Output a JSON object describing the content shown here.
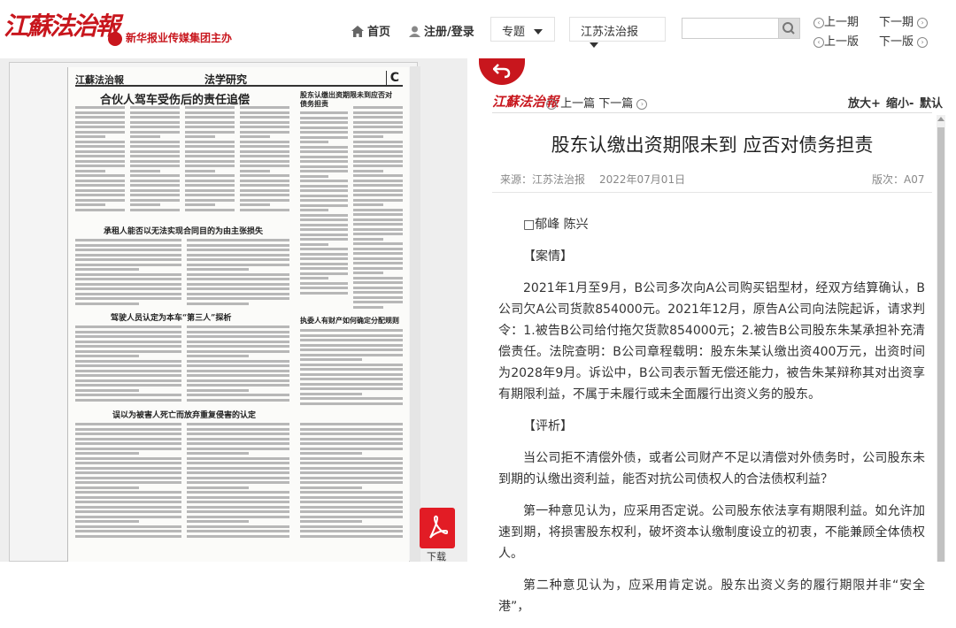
{
  "header": {
    "logo_text": "江蘇法治報",
    "logo_sub": "新华报业传媒集团主办",
    "nav_home": "首页",
    "nav_login": "注册/登录",
    "dropdown_topic": "专题",
    "dropdown_paper": "江苏法治报",
    "prev_issue": "上一期",
    "next_issue": "下一期",
    "prev_page": "上一版",
    "next_page": "下一版"
  },
  "newspaper": {
    "masthead": "江蘇法治報",
    "section": "法学研究",
    "page_letter": "C",
    "headlines": [
      "合伙人驾车受伤后的责任追偿",
      "股东认缴出资期限未到应否对债务担责",
      "承租人能否以无法实现合同目的为由主张损失",
      "驾驶人员认定为本车“第三人”探析",
      "执委人有财产如何确定分配规则",
      "误以为被害人死亡而放弃重复侵害的认定"
    ],
    "download_label": "下载"
  },
  "article": {
    "logo": "江蘇法治報",
    "prev_article": "上一篇",
    "next_article": "下一篇",
    "zoom_in": "放大+",
    "zoom_out": "缩小-",
    "default_size": "默认",
    "title": "股东认缴出资期限未到 应否对债务担责",
    "source": "来源：江苏法治报",
    "date": "2022年07月01日",
    "edition": "版次：A07",
    "author": "□郁峰 陈兴",
    "section_case": "【案情】",
    "para_case": "2021年1月至9月，B公司多次向A公司购买铝型材，经双方结算确认，B公司欠A公司货款854000元。2021年12月，原告A公司向法院起诉，请求判令：1.被告B公司给付拖欠货款854000元；2.被告B公司股东朱某承担补充清偿责任。法院查明：B公司章程载明：股东朱某认缴出资400万元，出资时间为2028年9月。诉讼中，B公司表示暂无偿还能力，被告朱某辩称其对出资享有期限利益，不属于未履行或未全面履行出资义务的股东。",
    "section_review": "【评析】",
    "para_review1": "当公司拒不清偿外债，或者公司财产不足以清偿对外债务时，公司股东未到期的认缴出资利益，能否对抗公司债权人的合法债权利益？",
    "para_review2": "第一种意见认为，应采用否定说。公司股东依法享有期限利益。如允许加速到期，将损害股东权利，破坏资本认缴制度设立的初衷，不能兼顾全体债权人。",
    "para_review3": "第二种意见认为，应采用肯定说。股东出资义务的履行期限并非“安全港”，"
  },
  "colors": {
    "brand_red": "#c8161d",
    "pdf_red": "#e21c25"
  }
}
